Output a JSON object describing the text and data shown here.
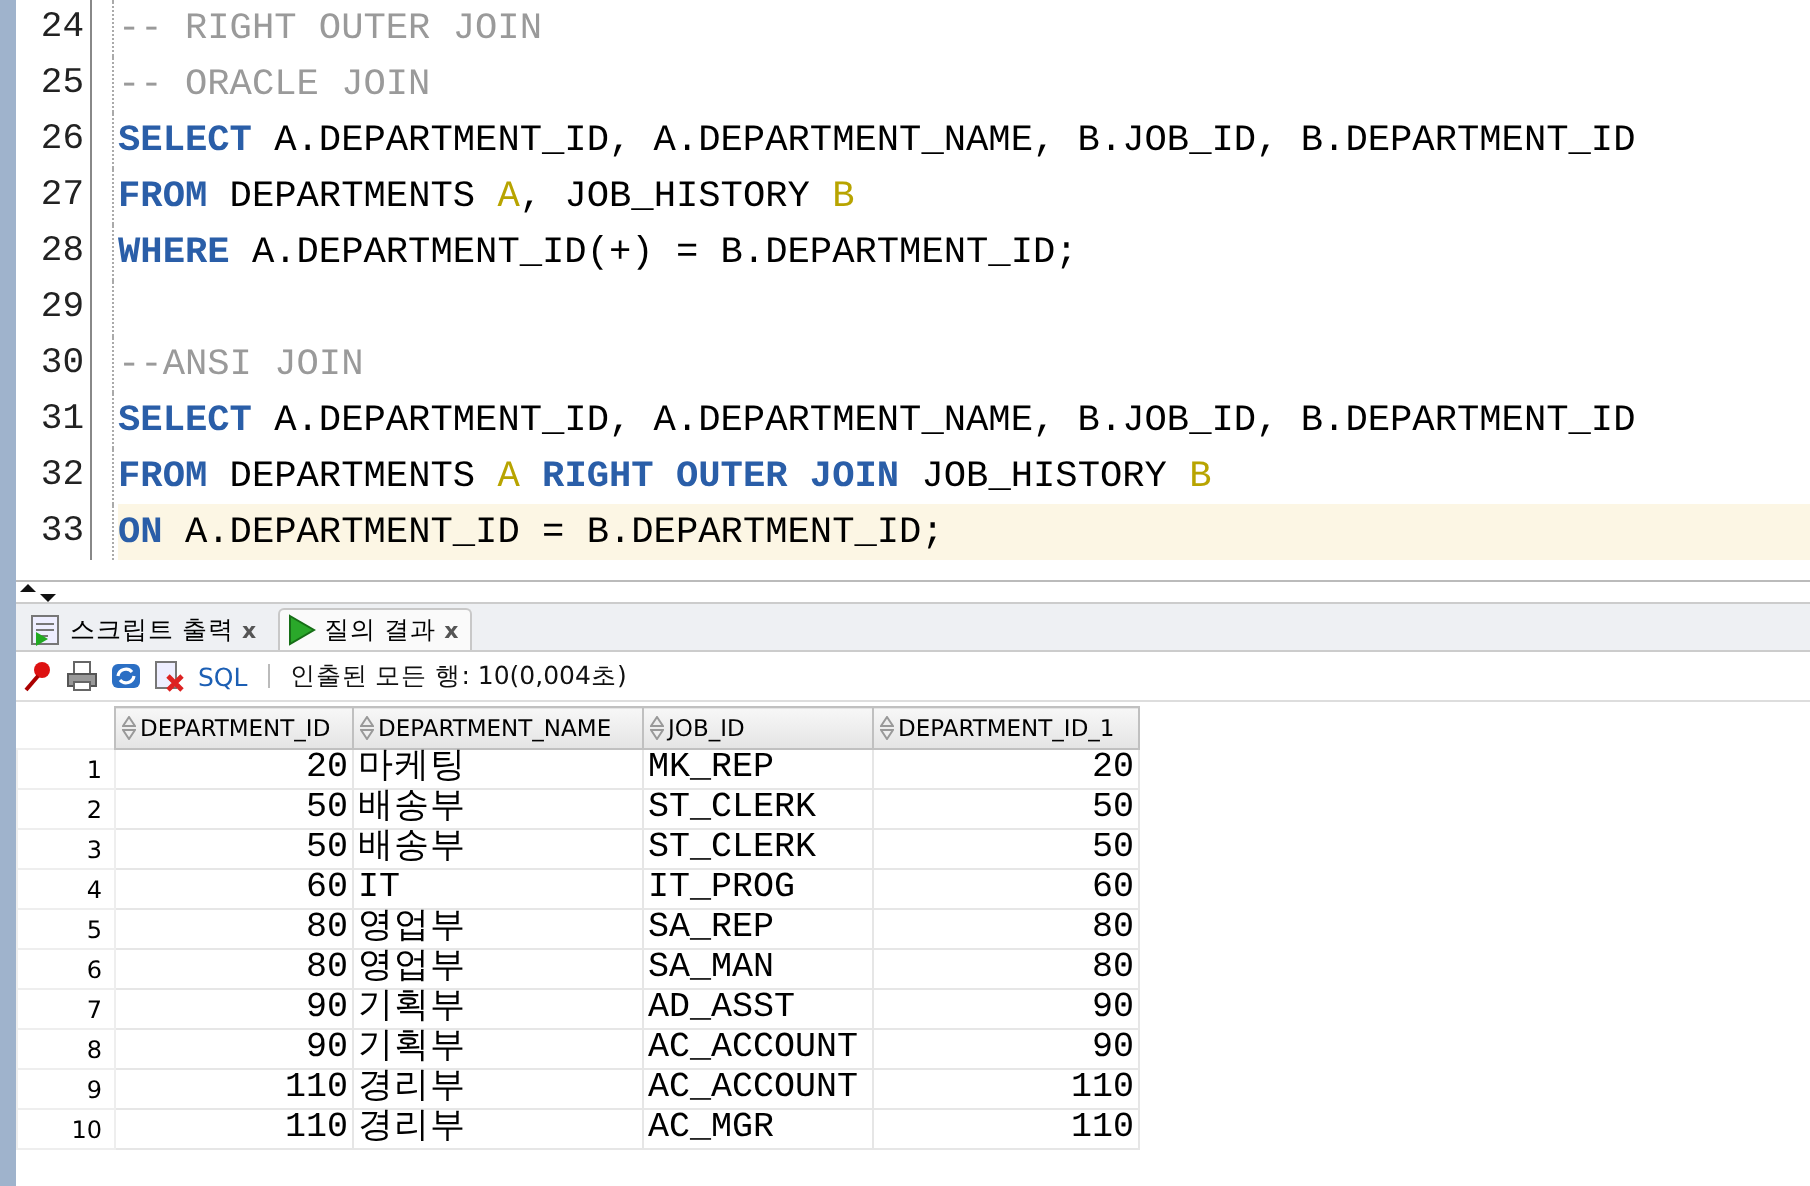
{
  "editor": {
    "lines": [
      {
        "number": "24",
        "highlighted": false,
        "tokens": [
          {
            "kind": "comment",
            "text": "-- RIGHT OUTER JOIN"
          }
        ]
      },
      {
        "number": "25",
        "highlighted": false,
        "tokens": [
          {
            "kind": "comment",
            "text": "-- ORACLE JOIN"
          }
        ]
      },
      {
        "number": "26",
        "highlighted": false,
        "tokens": [
          {
            "kind": "keyword",
            "text": "SELECT"
          },
          {
            "kind": "plain",
            "text": " A.DEPARTMENT_ID, A.DEPARTMENT_NAME, B.JOB_ID, B.DEPARTMENT_ID"
          }
        ]
      },
      {
        "number": "27",
        "highlighted": false,
        "tokens": [
          {
            "kind": "keyword",
            "text": "FROM"
          },
          {
            "kind": "plain",
            "text": " DEPARTMENTS "
          },
          {
            "kind": "alias",
            "text": "A"
          },
          {
            "kind": "plain",
            "text": ", JOB_HISTORY "
          },
          {
            "kind": "alias",
            "text": "B"
          }
        ]
      },
      {
        "number": "28",
        "highlighted": false,
        "tokens": [
          {
            "kind": "keyword",
            "text": "WHERE"
          },
          {
            "kind": "plain",
            "text": " A.DEPARTMENT_ID(+) = B.DEPARTMENT_ID;"
          }
        ]
      },
      {
        "number": "29",
        "highlighted": false
      },
      {
        "number": "30",
        "highlighted": false,
        "tokens": [
          {
            "kind": "comment",
            "text": "--ANSI JOIN"
          }
        ]
      },
      {
        "number": "31",
        "highlighted": false,
        "tokens": [
          {
            "kind": "keyword",
            "text": "SELECT"
          },
          {
            "kind": "plain",
            "text": " A.DEPARTMENT_ID, A.DEPARTMENT_NAME, B.JOB_ID, B.DEPARTMENT_ID"
          }
        ]
      },
      {
        "number": "32",
        "highlighted": false,
        "tokens": [
          {
            "kind": "keyword",
            "text": "FROM"
          },
          {
            "kind": "plain",
            "text": " DEPARTMENTS "
          },
          {
            "kind": "alias",
            "text": "A"
          },
          {
            "kind": "keyword",
            "text": " RIGHT OUTER JOIN"
          },
          {
            "kind": "plain",
            "text": " JOB_HISTORY "
          },
          {
            "kind": "alias",
            "text": "B"
          }
        ]
      },
      {
        "number": "33",
        "highlighted": true,
        "tokens": [
          {
            "kind": "keyword",
            "text": "ON"
          },
          {
            "kind": "plain",
            "text": " A.DEPARTMENT_ID = B.DEPARTMENT_ID;"
          }
        ]
      }
    ]
  },
  "panel": {
    "tabs": [
      {
        "label": "스크립트 출력",
        "close": "x",
        "selected": false
      },
      {
        "label": "질의 결과",
        "close": "x",
        "selected": true
      }
    ],
    "toolbar": {
      "sql_link": "SQL",
      "status": "인출된 모든 행: 10(0,004초)"
    },
    "grid": {
      "columns": [
        {
          "label": "DEPARTMENT_ID",
          "kind": "number"
        },
        {
          "label": "DEPARTMENT_NAME",
          "kind": "text"
        },
        {
          "label": "JOB_ID",
          "kind": "text"
        },
        {
          "label": "DEPARTMENT_ID_1",
          "kind": "number"
        }
      ],
      "rows": [
        {
          "number": "1",
          "cells": [
            "20",
            "마케팅",
            "MK_REP",
            "20"
          ]
        },
        {
          "number": "2",
          "cells": [
            "50",
            "배송부",
            "ST_CLERK",
            "50"
          ]
        },
        {
          "number": "3",
          "cells": [
            "50",
            "배송부",
            "ST_CLERK",
            "50"
          ]
        },
        {
          "number": "4",
          "cells": [
            "60",
            "IT",
            "IT_PROG",
            "60"
          ]
        },
        {
          "number": "5",
          "cells": [
            "80",
            "영업부",
            "SA_REP",
            "80"
          ]
        },
        {
          "number": "6",
          "cells": [
            "80",
            "영업부",
            "SA_MAN",
            "80"
          ]
        },
        {
          "number": "7",
          "cells": [
            "90",
            "기획부",
            "AD_ASST",
            "90"
          ]
        },
        {
          "number": "8",
          "cells": [
            "90",
            "기획부",
            "AC_ACCOUNT",
            "90"
          ]
        },
        {
          "number": "9",
          "cells": [
            "110",
            "경리부",
            "AC_ACCOUNT",
            "110"
          ]
        },
        {
          "number": "10",
          "cells": [
            "110",
            "경리부",
            "AC_MGR",
            "110"
          ]
        }
      ]
    }
  }
}
